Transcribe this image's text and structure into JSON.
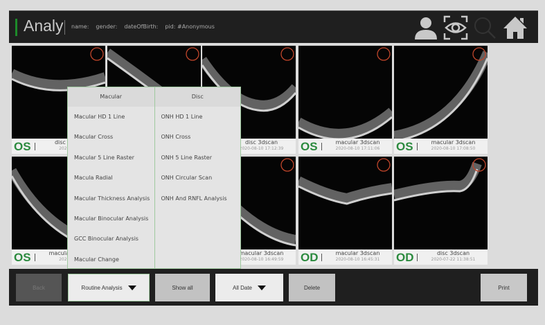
{
  "header": {
    "title": "Analy",
    "name_label": "name:",
    "gender_label": "gender:",
    "dob_label": "dateOfBirth:",
    "pid_label": "pid:",
    "pid_value": "#Anonymous"
  },
  "colors": {
    "accent": "#2b8a3e",
    "header_bg": "#1f1f1f",
    "marker": "#c0452a"
  },
  "cards": [
    {
      "eye": "OS",
      "name": "disc 3dscan",
      "date": "2020-08-10"
    },
    {
      "eye": "",
      "name": "",
      "date": ""
    },
    {
      "eye": "",
      "name": "disc 3dscan",
      "date": "2020-08-10 17:12:39"
    },
    {
      "eye": "OS",
      "name": "macular 3dscan",
      "date": "2020-08-10 17:11:06"
    },
    {
      "eye": "OS",
      "name": "macular 3dscan",
      "date": "2020-08-10 17:08:50"
    },
    {
      "eye": "OS",
      "name": "macular 3dscan",
      "date": "2020-08-10"
    },
    {
      "eye": "",
      "name": "",
      "date": ""
    },
    {
      "eye": "",
      "name": "macular 3dscan",
      "date": "2020-08-10 16:49:59"
    },
    {
      "eye": "OD",
      "name": "macular 3dscan",
      "date": "2020-08-10 16:45:31"
    },
    {
      "eye": "OD",
      "name": "disc 3dscan",
      "date": "2020-07-22 11:38:51"
    }
  ],
  "menu": {
    "macular": {
      "title": "Macular",
      "items": [
        "Macular HD 1 Line",
        "Macular Cross",
        "Macular 5 Line Raster",
        "Macula Radial",
        "Macular Thickness Analysis",
        "Macular Binocular Analysis",
        "GCC Binocular Analysis",
        "Macular Change"
      ]
    },
    "disc": {
      "title": "Disc",
      "items": [
        "ONH HD 1 Line",
        "ONH Cross",
        "ONH 5 Line Raster",
        "ONH Circular Scan",
        "ONH And RNFL Analysis"
      ]
    }
  },
  "toolbar": {
    "back": "Back",
    "analysis": "Routine Analysis",
    "show_all": "Show all",
    "date_filter": "All Date",
    "delete": "Delete",
    "print": "Print"
  }
}
